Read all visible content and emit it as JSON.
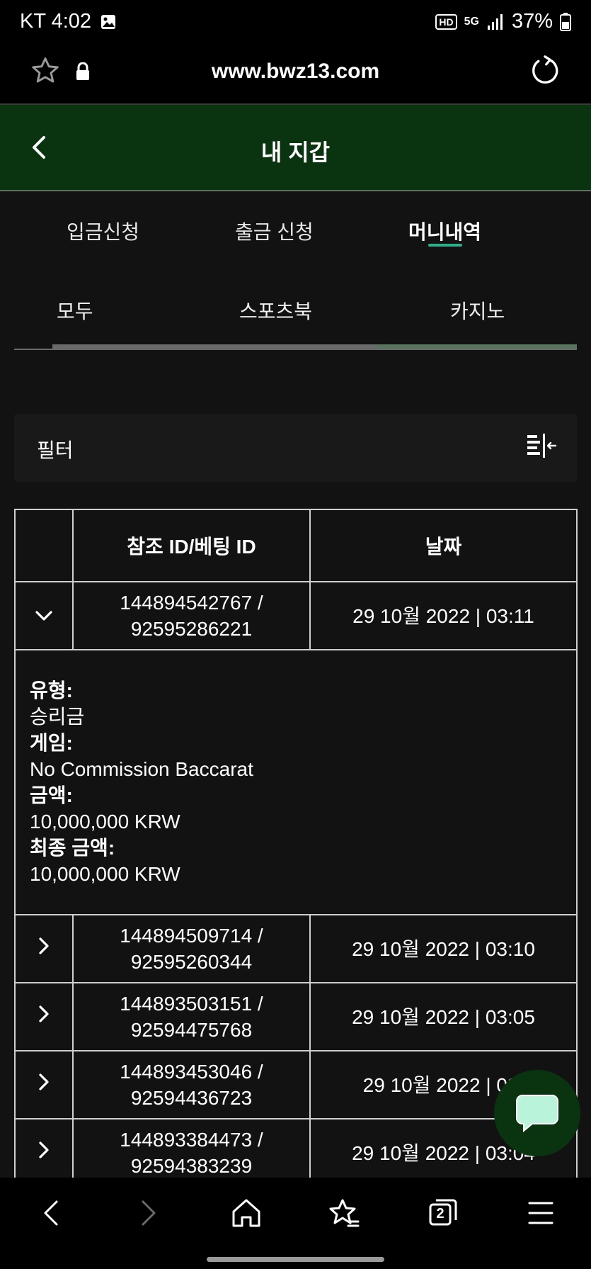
{
  "status_bar": {
    "carrier_time": "KT 4:02",
    "hd_badge": "HD",
    "network": "5G",
    "battery": "37%"
  },
  "browser": {
    "url": "www.bwz13.com"
  },
  "header": {
    "title": "내 지갑"
  },
  "tabs": [
    {
      "label": "입금신청"
    },
    {
      "label": "출금 신청"
    },
    {
      "label": "머니내역"
    }
  ],
  "subtabs": [
    {
      "label": "모두"
    },
    {
      "label": "스포츠북"
    },
    {
      "label": "카지노"
    }
  ],
  "filter": {
    "label": "필터"
  },
  "table": {
    "headers": {
      "ref": "참조 ID/베팅 ID",
      "date": "날짜"
    },
    "rows": [
      {
        "ref": "144894542767 /",
        "bet": "92595286221",
        "date": "29 10월 2022 | 03:11"
      },
      {
        "ref": "144894509714 /",
        "bet": "92595260344",
        "date": "29 10월 2022 | 03:10"
      },
      {
        "ref": "144893503151 /",
        "bet": "92594475768",
        "date": "29 10월 2022 | 03:05"
      },
      {
        "ref": "144893453046 /",
        "bet": "92594436723",
        "date": "29 10월 2022 | 03:"
      },
      {
        "ref": "144893384473 /",
        "bet": "92594383239",
        "date": "29 10월 2022 | 03:04"
      }
    ],
    "detail": {
      "type_label": "유형:",
      "type_value": "승리금",
      "game_label": "게임:",
      "game_value": "No Commission Baccarat",
      "amount_label": "금액:",
      "amount_value": "10,000,000 KRW",
      "final_label": "최종 금액:",
      "final_value": "10,000,000 KRW"
    }
  },
  "bottom_nav": {
    "tab_count": "2"
  },
  "colors": {
    "header_bg": "#0a3310",
    "accent": "#2fae8a",
    "main_bg": "#121212"
  }
}
